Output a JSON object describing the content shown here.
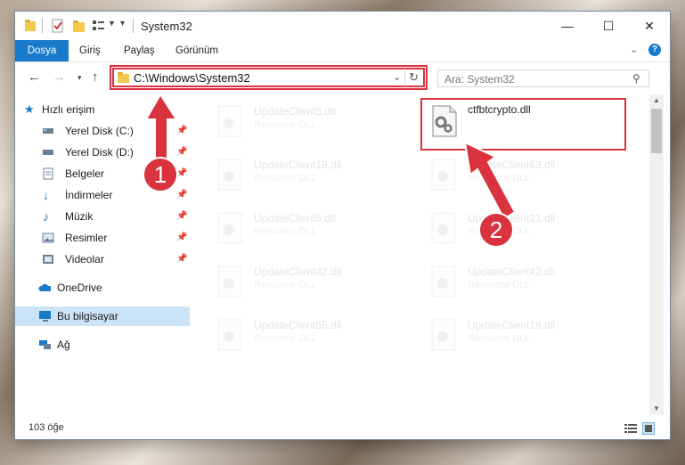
{
  "window": {
    "title": "System32",
    "controls": {
      "minimize": "—",
      "maximize": "☐",
      "close": "✕"
    }
  },
  "ribbon": {
    "tabs": [
      {
        "label": "Dosya",
        "active": true
      },
      {
        "label": "Giriş"
      },
      {
        "label": "Paylaş"
      },
      {
        "label": "Görünüm"
      }
    ]
  },
  "address": {
    "path": "C:\\Windows\\System32",
    "search_placeholder": "Ara: System32"
  },
  "sidebar": {
    "items": [
      {
        "label": "Hızlı erişim",
        "icon": "star-icon",
        "pinned": false
      },
      {
        "label": "Yerel Disk (C:)",
        "icon": "drive-icon",
        "pinned": true
      },
      {
        "label": "Yerel Disk (D:)",
        "icon": "drive-icon",
        "pinned": true
      },
      {
        "label": "Belgeler",
        "icon": "documents-icon",
        "pinned": true
      },
      {
        "label": "İndirmeler",
        "icon": "download-icon",
        "pinned": true
      },
      {
        "label": "Müzik",
        "icon": "music-icon",
        "pinned": true
      },
      {
        "label": "Resimler",
        "icon": "pictures-icon",
        "pinned": true
      },
      {
        "label": "Videolar",
        "icon": "videos-icon",
        "pinned": true
      },
      {
        "label": "OneDrive",
        "icon": "cloud-icon",
        "pinned": false
      },
      {
        "label": "Bu bilgisayar",
        "icon": "computer-icon",
        "pinned": false,
        "selected": true
      },
      {
        "label": "Ağ",
        "icon": "network-icon",
        "pinned": false
      }
    ]
  },
  "files": {
    "highlighted": {
      "name": "ctfbtcrypto.dll"
    },
    "faded": [
      {
        "name": "UpdateClient5.dll",
        "type": "Resource DLL"
      },
      {
        "name": "UpdateClient19.dll",
        "type": "Resource DLL"
      },
      {
        "name": "UpdateClient63.dll",
        "type": "Resource DLL"
      },
      {
        "name": "UpdateClient5.dll",
        "type": "Resource DLL"
      },
      {
        "name": "UpdateClient21.dll",
        "type": "Resource DLL"
      },
      {
        "name": "UpdateClient42.dll",
        "type": "Resource DLL"
      },
      {
        "name": "UpdateClient42.dll",
        "type": "Resource DLL"
      },
      {
        "name": "UpdateClient65.dll",
        "type": "Resource DLL"
      },
      {
        "name": "UpdateClient19.dll",
        "type": "Resource DLL"
      }
    ]
  },
  "status": {
    "count": "103 öğe"
  },
  "annotations": {
    "badge1": "1",
    "badge2": "2",
    "color": "#d9333f"
  }
}
